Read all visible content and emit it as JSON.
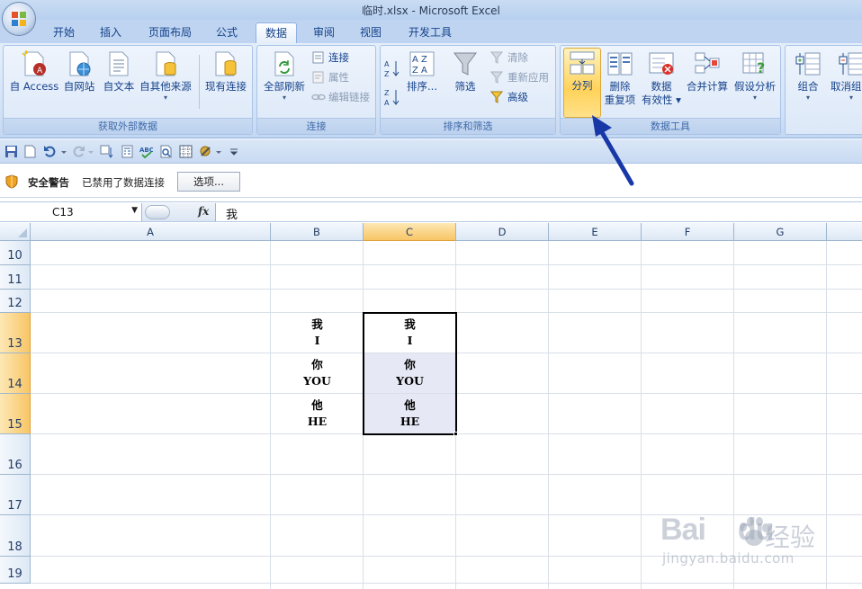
{
  "window": {
    "title": "临时.xlsx - Microsoft Excel"
  },
  "tabs": [
    "开始",
    "插入",
    "页面布局",
    "公式",
    "数据",
    "审阅",
    "视图",
    "开发工具"
  ],
  "active_tab": "数据",
  "ribbon": {
    "external_data": {
      "label": "获取外部数据",
      "access": "自 Access",
      "web": "自网站",
      "text": "自文本",
      "other": "自其他来源",
      "existing": "现有连接"
    },
    "connections": {
      "label": "连接",
      "refresh_all": "全部刷新",
      "connections": "连接",
      "properties": "属性",
      "edit_links": "编辑链接"
    },
    "sort_filter": {
      "label": "排序和筛选",
      "sort": "排序...",
      "filter": "筛选",
      "clear": "清除",
      "reapply": "重新应用",
      "advanced": "高级"
    },
    "data_tools": {
      "label": "数据工具",
      "text_to_columns": "分列",
      "remove_dup_1": "删除",
      "remove_dup_2": "重复项",
      "validation_1": "数据",
      "validation_2": "有效性",
      "consolidate": "合并计算",
      "whatif": "假设分析"
    },
    "outline": {
      "group": "组合",
      "ungroup": "取消组合"
    }
  },
  "security": {
    "title": "安全警告",
    "message": "已禁用了数据连接",
    "options": "选项..."
  },
  "formula_bar": {
    "name_box": "C13",
    "fx": "fx",
    "value": "我"
  },
  "columns": [
    "A",
    "B",
    "C",
    "D",
    "E",
    "F",
    "G"
  ],
  "rows": [
    "10",
    "11",
    "12",
    "13",
    "14",
    "15",
    "16",
    "17",
    "18",
    "19"
  ],
  "cells": {
    "B13": [
      "我",
      "I"
    ],
    "B14": [
      "你",
      "YOU"
    ],
    "B15": [
      "他",
      "HE"
    ],
    "C13": [
      "我",
      "I"
    ],
    "C14": [
      "你",
      "YOU"
    ],
    "C15": [
      "他",
      "HE"
    ]
  },
  "watermark": {
    "brand": "Bai",
    "brand2": "du",
    "cn": "经验",
    "url": "jingyan.baidu.com"
  }
}
